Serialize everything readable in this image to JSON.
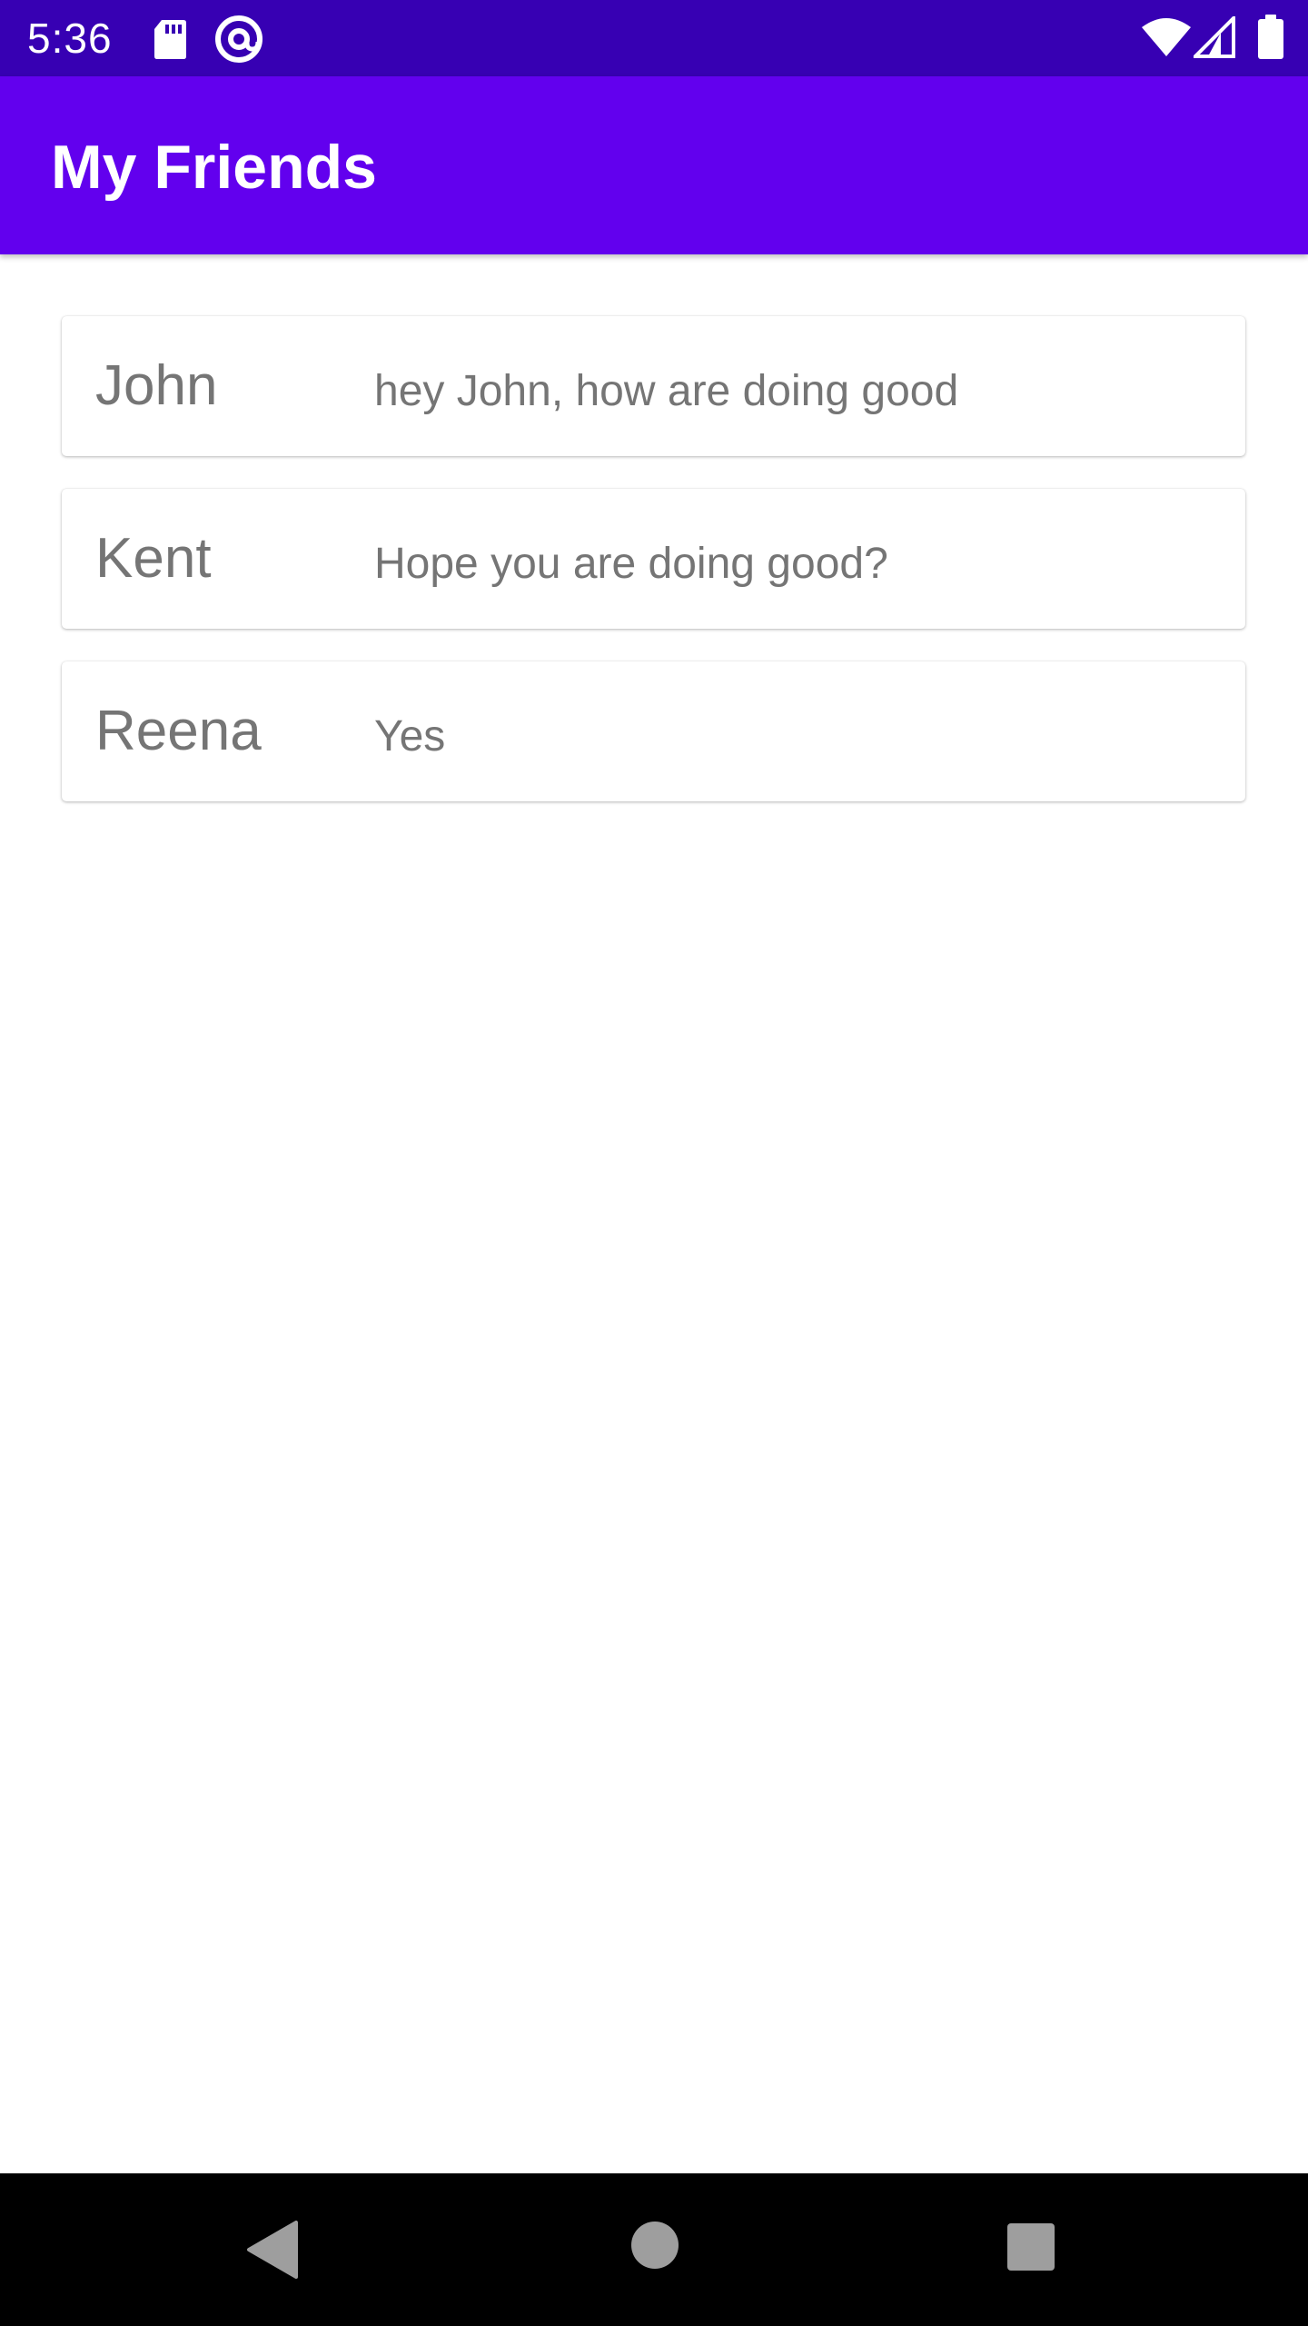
{
  "status_bar": {
    "time": "5:36",
    "icons": [
      "sd-card-icon",
      "at-sign-icon",
      "wifi-icon",
      "cellular-signal-icon",
      "battery-icon"
    ],
    "background": "#3700b3"
  },
  "app_bar": {
    "title": "My Friends",
    "background": "#6200ee"
  },
  "friends": [
    {
      "name": "John",
      "message": "hey John, how are doing good"
    },
    {
      "name": "Kent",
      "message": "Hope you are doing good?"
    },
    {
      "name": "Reena",
      "message": "Yes"
    }
  ],
  "nav_bar": {
    "buttons": [
      "back-icon",
      "home-icon",
      "recents-icon"
    ],
    "icon_color": "#9e9e9e"
  }
}
